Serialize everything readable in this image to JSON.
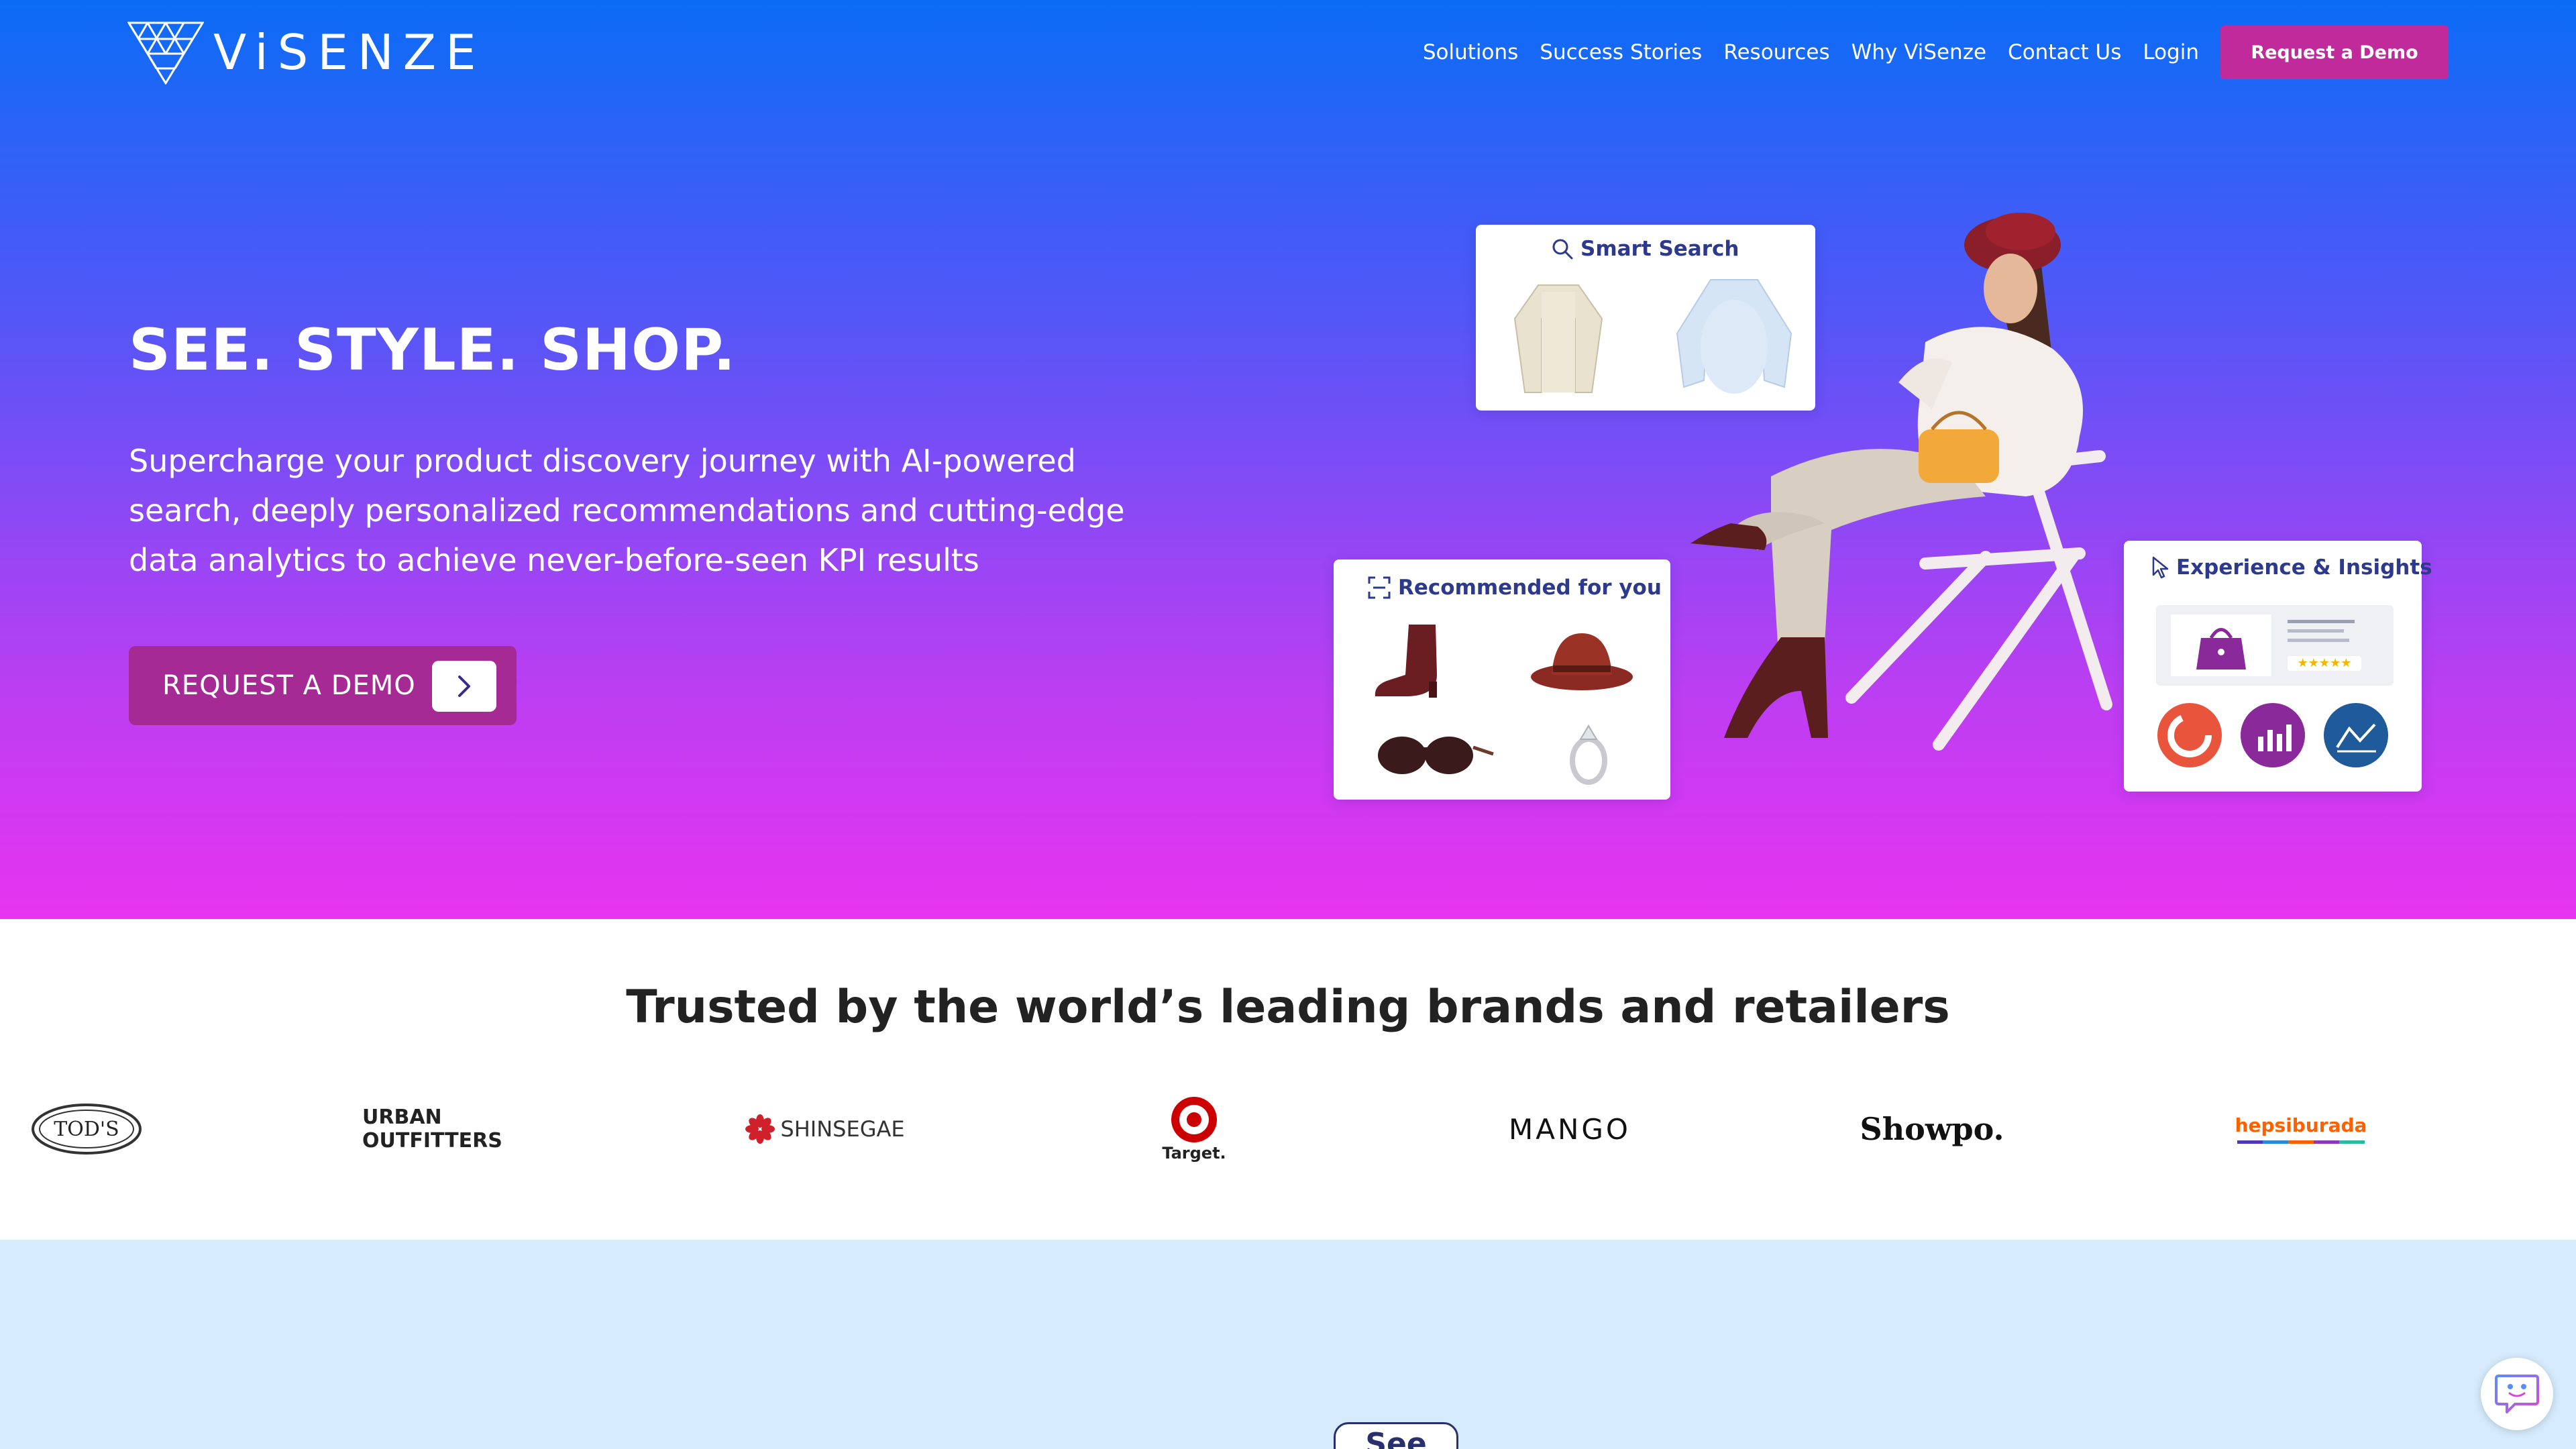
{
  "brand": {
    "name": "ViSENZE",
    "logo_icon": "visenze-triangle-logo"
  },
  "nav": {
    "links": [
      "Solutions",
      "Success Stories",
      "Resources",
      "Why ViSenze",
      "Contact Us",
      "Login"
    ],
    "cta": "Request a Demo"
  },
  "hero": {
    "title": "SEE. STYLE. SHOP.",
    "subtitle": "Supercharge your product discovery journey with AI-powered search, deeply personalized recommendations and cutting-edge data analytics to achieve never-before-seen KPI results",
    "cta": "REQUEST A DEMO",
    "cards": {
      "smart_search": "Smart Search",
      "recommended": "Recommended for you",
      "insights": "Experience & Insights"
    }
  },
  "trusted": {
    "title": "Trusted by the world’s leading brands and retailers",
    "brands": [
      "TOD'S",
      "URBAN OUTFITTERS",
      "SHINSEGAE",
      "Target.",
      "MANGO",
      "Showpo.",
      "hepsiburada"
    ]
  },
  "next_section": {
    "pill_label": "See"
  },
  "colors": {
    "gradient_top": "#0a6cf5",
    "gradient_bottom": "#e734f0",
    "cta": "#c02a9a",
    "cta_hero": "#a62a93",
    "next_bg": "#d6ecfc"
  }
}
